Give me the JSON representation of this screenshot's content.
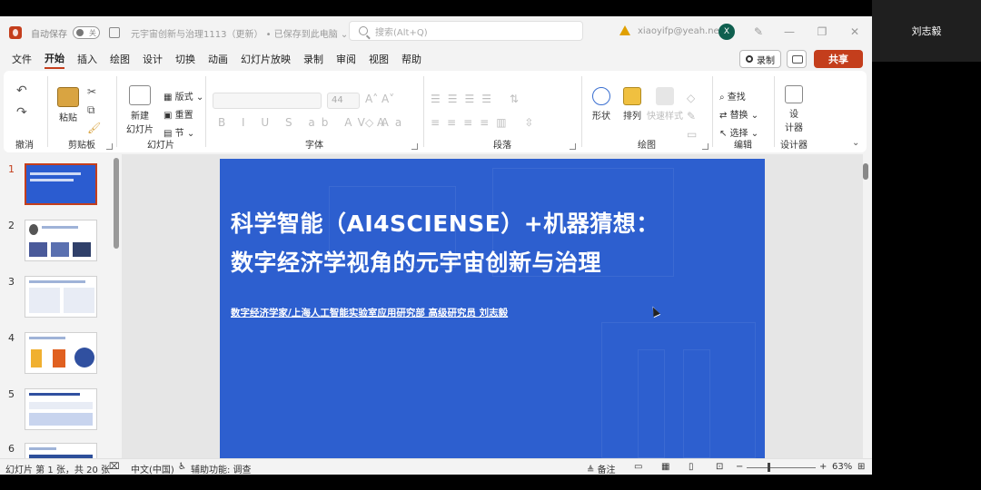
{
  "titlebar": {
    "autosave_label": "自动保存",
    "autosave_state": "关",
    "doc_title": "元宇宙创新与治理1113（更新） • 已保存到此电脑 ⌄",
    "search_placeholder": "搜索(Alt+Q)",
    "account_email": "xiaoyifp@yeah.net",
    "avatar_initial": "X"
  },
  "menu": {
    "tabs": [
      "文件",
      "开始",
      "插入",
      "绘图",
      "设计",
      "切换",
      "动画",
      "幻灯片放映",
      "录制",
      "审阅",
      "视图",
      "帮助"
    ],
    "active_tab": "开始",
    "record_label": "录制",
    "share_label": "共享"
  },
  "ribbon": {
    "groups": {
      "undo": "撤消",
      "clipboard": "剪贴板",
      "slides": "幻灯片",
      "font": "字体",
      "paragraph": "段落",
      "drawing": "绘图",
      "editing": "编辑",
      "designer": "设计器"
    },
    "paste_label": "粘贴",
    "new_slide_label_1": "新建",
    "new_slide_label_2": "幻灯片",
    "layout_label": "版式",
    "reset_label": "重置",
    "section_label": "节",
    "font_size": "44",
    "shape_label": "形状",
    "arrange_label": "排列",
    "quick_styles_label": "快速样式",
    "find_label": "查找",
    "replace_label": "替换",
    "select_label": "选择",
    "designer_label_1": "设",
    "designer_label_2": "计器"
  },
  "thumbnails": [
    {
      "number": "1"
    },
    {
      "number": "2"
    },
    {
      "number": "3"
    },
    {
      "number": "4"
    },
    {
      "number": "5"
    },
    {
      "number": "6"
    }
  ],
  "slide": {
    "title_line1": "科学智能（AI4SCIENSE）+机器猜想：",
    "title_line2": "数字经济学视角的元宇宙创新与治理",
    "subtitle": "数字经济学家/上海人工智能实验室应用研究部  高级研究员  刘志毅",
    "background_color": "#2d5fcf"
  },
  "statusbar": {
    "slide_info": "幻灯片 第 1 张，共 20 张",
    "language": "中文(中国)",
    "accessibility": "辅助功能: 调查",
    "notes_label": "备注",
    "zoom_level": "63%"
  },
  "side_panel": {
    "participant_name": "刘志毅"
  }
}
